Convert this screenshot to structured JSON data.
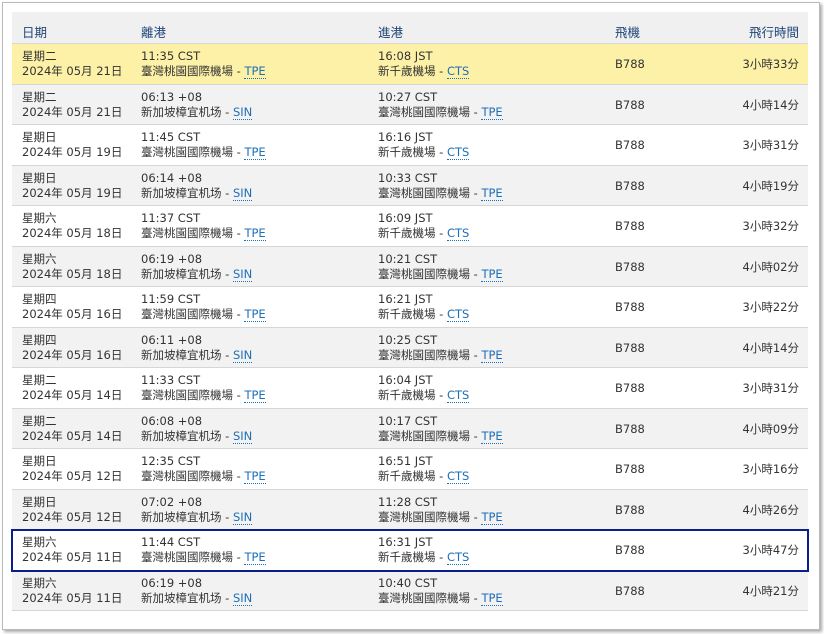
{
  "header": {
    "date": "日期",
    "departure": "離港",
    "arrival": "進港",
    "aircraft": "飛機",
    "duration": "飛行時間"
  },
  "rows": [
    {
      "weekday": "星期二",
      "date": "2024年 05月 21日",
      "dep_time": "11:35 CST",
      "dep_airport": "臺灣桃園國際機場",
      "dep_code": "TPE",
      "arr_time": "16:08 JST",
      "arr_airport": "新千歲機場",
      "arr_code": "CTS",
      "aircraft": "B788",
      "duration": "3小時33分"
    },
    {
      "weekday": "星期二",
      "date": "2024年 05月 21日",
      "dep_time": "06:13 +08",
      "dep_airport": "新加坡樟宜机场",
      "dep_code": "SIN",
      "arr_time": "10:27 CST",
      "arr_airport": "臺灣桃園國際機場",
      "arr_code": "TPE",
      "aircraft": "B788",
      "duration": "4小時14分"
    },
    {
      "weekday": "星期日",
      "date": "2024年 05月 19日",
      "dep_time": "11:45 CST",
      "dep_airport": "臺灣桃園國際機場",
      "dep_code": "TPE",
      "arr_time": "16:16 JST",
      "arr_airport": "新千歲機場",
      "arr_code": "CTS",
      "aircraft": "B788",
      "duration": "3小時31分"
    },
    {
      "weekday": "星期日",
      "date": "2024年 05月 19日",
      "dep_time": "06:14 +08",
      "dep_airport": "新加坡樟宜机场",
      "dep_code": "SIN",
      "arr_time": "10:33 CST",
      "arr_airport": "臺灣桃園國際機場",
      "arr_code": "TPE",
      "aircraft": "B788",
      "duration": "4小時19分"
    },
    {
      "weekday": "星期六",
      "date": "2024年 05月 18日",
      "dep_time": "11:37 CST",
      "dep_airport": "臺灣桃園國際機場",
      "dep_code": "TPE",
      "arr_time": "16:09 JST",
      "arr_airport": "新千歲機場",
      "arr_code": "CTS",
      "aircraft": "B788",
      "duration": "3小時32分"
    },
    {
      "weekday": "星期六",
      "date": "2024年 05月 18日",
      "dep_time": "06:19 +08",
      "dep_airport": "新加坡樟宜机场",
      "dep_code": "SIN",
      "arr_time": "10:21 CST",
      "arr_airport": "臺灣桃園國際機場",
      "arr_code": "TPE",
      "aircraft": "B788",
      "duration": "4小時02分"
    },
    {
      "weekday": "星期四",
      "date": "2024年 05月 16日",
      "dep_time": "11:59 CST",
      "dep_airport": "臺灣桃園國際機場",
      "dep_code": "TPE",
      "arr_time": "16:21 JST",
      "arr_airport": "新千歲機場",
      "arr_code": "CTS",
      "aircraft": "B788",
      "duration": "3小時22分"
    },
    {
      "weekday": "星期四",
      "date": "2024年 05月 16日",
      "dep_time": "06:11 +08",
      "dep_airport": "新加坡樟宜机场",
      "dep_code": "SIN",
      "arr_time": "10:25 CST",
      "arr_airport": "臺灣桃園國際機場",
      "arr_code": "TPE",
      "aircraft": "B788",
      "duration": "4小時14分"
    },
    {
      "weekday": "星期二",
      "date": "2024年 05月 14日",
      "dep_time": "11:33 CST",
      "dep_airport": "臺灣桃園國際機場",
      "dep_code": "TPE",
      "arr_time": "16:04 JST",
      "arr_airport": "新千歲機場",
      "arr_code": "CTS",
      "aircraft": "B788",
      "duration": "3小時31分"
    },
    {
      "weekday": "星期二",
      "date": "2024年 05月 14日",
      "dep_time": "06:08 +08",
      "dep_airport": "新加坡樟宜机场",
      "dep_code": "SIN",
      "arr_time": "10:17 CST",
      "arr_airport": "臺灣桃園國際機場",
      "arr_code": "TPE",
      "aircraft": "B788",
      "duration": "4小時09分"
    },
    {
      "weekday": "星期日",
      "date": "2024年 05月 12日",
      "dep_time": "12:35 CST",
      "dep_airport": "臺灣桃園國際機場",
      "dep_code": "TPE",
      "arr_time": "16:51 JST",
      "arr_airport": "新千歲機場",
      "arr_code": "CTS",
      "aircraft": "B788",
      "duration": "3小時16分"
    },
    {
      "weekday": "星期日",
      "date": "2024年 05月 12日",
      "dep_time": "07:02 +08",
      "dep_airport": "新加坡樟宜机场",
      "dep_code": "SIN",
      "arr_time": "11:28 CST",
      "arr_airport": "臺灣桃園國際機場",
      "arr_code": "TPE",
      "aircraft": "B788",
      "duration": "4小時26分"
    },
    {
      "weekday": "星期六",
      "date": "2024年 05月 11日",
      "dep_time": "11:44 CST",
      "dep_airport": "臺灣桃園國際機場",
      "dep_code": "TPE",
      "arr_time": "16:31 JST",
      "arr_airport": "新千歲機場",
      "arr_code": "CTS",
      "aircraft": "B788",
      "duration": "3小時47分"
    },
    {
      "weekday": "星期六",
      "date": "2024年 05月 11日",
      "dep_time": "06:19 +08",
      "dep_airport": "新加坡樟宜机场",
      "dep_code": "SIN",
      "arr_time": "10:40 CST",
      "arr_airport": "臺灣桃園國際機場",
      "arr_code": "TPE",
      "aircraft": "B788",
      "duration": "4小時21分"
    }
  ],
  "highlighted_row": 0,
  "selected_row": 12,
  "colors": {
    "header_text": "#21467a",
    "link": "#1d6fb8",
    "highlight": "#fcf1a7",
    "selection_border": "#0a1e8c"
  }
}
